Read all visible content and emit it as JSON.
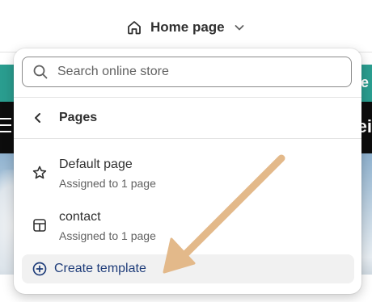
{
  "topbar": {
    "page_selector_label": "Home page"
  },
  "background": {
    "banner_text": "e",
    "header_text": "ei"
  },
  "dropdown": {
    "search": {
      "placeholder": "Search online store"
    },
    "back_label": "Pages",
    "items": [
      {
        "name": "Default page",
        "subtitle": "Assigned to 1 page",
        "icon": "star-icon"
      },
      {
        "name": "contact",
        "subtitle": "Assigned to 1 page",
        "icon": "layout-icon"
      }
    ],
    "create_label": "Create template"
  },
  "annotation": {
    "arrow_color": "#e3b98a"
  },
  "colors": {
    "accent_link": "#1f3d7a",
    "teal_banner": "#2a9d8f"
  }
}
